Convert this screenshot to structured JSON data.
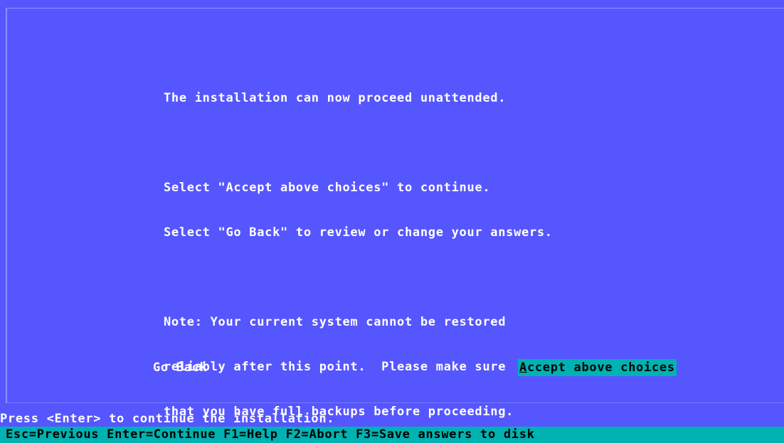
{
  "message": {
    "line1": "The installation can now proceed unattended.",
    "line2": "Select \"Accept above choices\" to continue.",
    "line3": "Select \"Go Back\" to review or change your answers.",
    "line4": "Note: Your current system cannot be restored",
    "line5": "reliably after this point.  Please make sure",
    "line6": "that you have full backups before proceeding."
  },
  "buttons": {
    "go_back": "Go Back",
    "accept_hotkey": "A",
    "accept_rest": "ccept above choices"
  },
  "status_line": "Press <Enter> to continue the installation.",
  "key_help": "Esc=Previous Enter=Continue F1=Help F2=Abort F3=Save answers to disk",
  "colors": {
    "background": "#5656ff",
    "highlight": "#00b2b2",
    "text": "#ffffff"
  }
}
